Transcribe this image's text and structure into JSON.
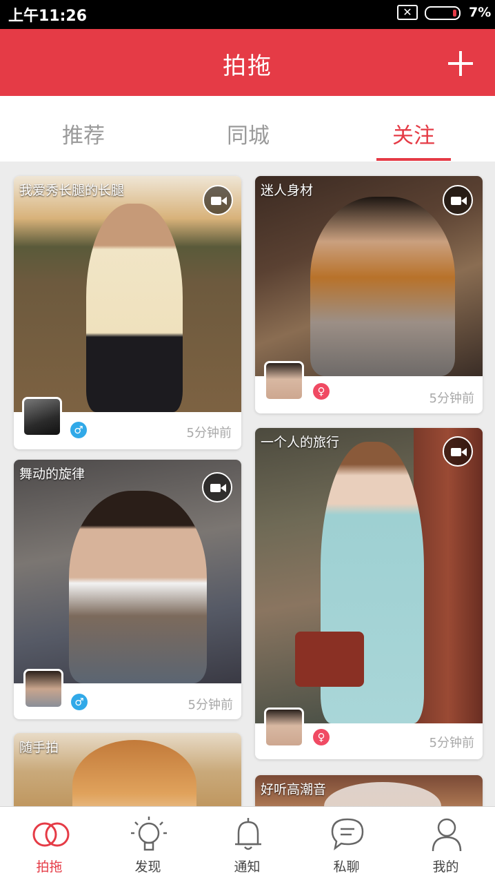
{
  "status_bar": {
    "time": "上午11:26",
    "sim": "✕",
    "battery_percent": "7%",
    "battery_level": 0.07
  },
  "header": {
    "title": "拍拖",
    "add_icon": "plus-icon"
  },
  "tabs": [
    {
      "label": "推荐",
      "active": false
    },
    {
      "label": "同城",
      "active": false
    },
    {
      "label": "关注",
      "active": true
    }
  ],
  "feed": {
    "cards": [
      {
        "title": "我爱秀长腿的长腿",
        "time": "5分钟前",
        "gender": "♂",
        "gender_type": "male",
        "media_icon": "video-camera-icon"
      },
      {
        "title": "迷人身材",
        "time": "5分钟前",
        "gender": "♀",
        "gender_type": "female",
        "media_icon": "video-camera-icon"
      },
      {
        "title": "舞动的旋律",
        "time": "5分钟前",
        "gender": "♂",
        "gender_type": "male",
        "media_icon": "video-camera-icon"
      },
      {
        "title": "一个人的旅行",
        "time": "5分钟前",
        "gender": "♀",
        "gender_type": "female",
        "media_icon": "video-camera-icon"
      },
      {
        "title": "随手拍"
      },
      {
        "title": "好听高潮音"
      }
    ]
  },
  "bottom_nav": [
    {
      "label": "拍拖",
      "icon": "rings-icon",
      "active": true
    },
    {
      "label": "发现",
      "icon": "lightbulb-icon",
      "active": false
    },
    {
      "label": "通知",
      "icon": "bell-icon",
      "active": false
    },
    {
      "label": "私聊",
      "icon": "chat-bubble-icon",
      "active": false
    },
    {
      "label": "我的",
      "icon": "person-icon",
      "active": false
    }
  ],
  "colors": {
    "accent": "#e53b46",
    "male": "#31a9e8",
    "female": "#f04a63",
    "muted_text": "#a8a8a8"
  }
}
